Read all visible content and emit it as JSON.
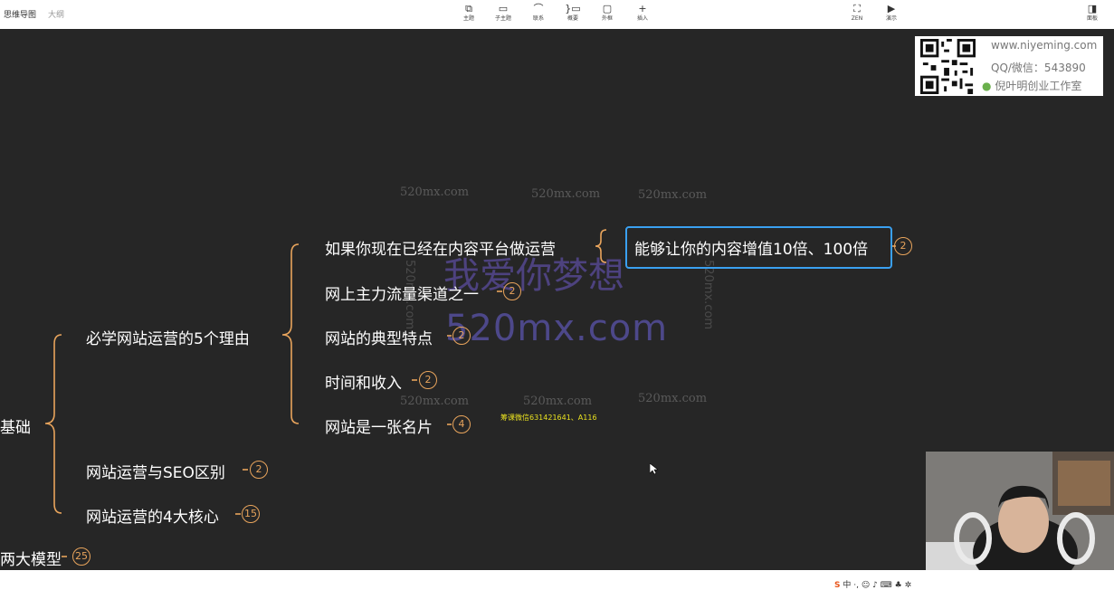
{
  "topbar": {
    "tab_mindmap": "思维导图",
    "tab_outline": "大纲",
    "tools": [
      {
        "icon": "topic-icon",
        "glyph": "⧉",
        "label": "主题"
      },
      {
        "icon": "subtopic-icon",
        "glyph": "▭",
        "label": "子主题"
      },
      {
        "icon": "relation-icon",
        "glyph": "⌒",
        "label": "联系"
      },
      {
        "icon": "summary-icon",
        "glyph": "}▭",
        "label": "概要"
      },
      {
        "icon": "boundary-icon",
        "glyph": "▢",
        "label": "外框"
      },
      {
        "icon": "insert-icon",
        "glyph": "+",
        "label": "插入"
      }
    ],
    "zen": {
      "icon": "zen-icon",
      "glyph": "⛶",
      "label": "ZEN"
    },
    "present": {
      "icon": "presentation-icon",
      "glyph": "▶",
      "label": "演示"
    },
    "panel": {
      "icon": "panel-icon",
      "glyph": "◨",
      "label": "面板"
    }
  },
  "mindmap": {
    "left_partial_1": "基础",
    "left_partial_2": "两大模型",
    "left_partial_2_badge": "25",
    "branch_reasons": "必学网站运营的5个理由",
    "branch_seo": "网站运营与SEO区别",
    "branch_seo_badge": "2",
    "branch_core": "网站运营的4大核心",
    "branch_core_badge": "15",
    "reasons": [
      {
        "label": "如果你现在已经在内容平台做运营",
        "badge": ""
      },
      {
        "label": "网上主力流量渠道之一",
        "badge": "2"
      },
      {
        "label": "网站的典型特点",
        "badge": "2"
      },
      {
        "label": "时间和收入",
        "badge": "2"
      },
      {
        "label": "网站是一张名片",
        "badge": "4"
      }
    ],
    "selected_node": "能够让你的内容增值10倍、100倍",
    "selected_badge": "2"
  },
  "watermarks": {
    "small": "520mx.com",
    "chinese": "我爱你梦想",
    "big": "520mx.com",
    "yellow": "筹课微信631421641、A116"
  },
  "ad": {
    "site": "www.niyeming.com",
    "qq": "QQ/微信：543890",
    "studio": "倪叶明创业工作室"
  },
  "colors": {
    "canvas": "#262626",
    "branch": "#e8a45c",
    "selection": "#3aa0f0",
    "text": "#ffffff"
  }
}
